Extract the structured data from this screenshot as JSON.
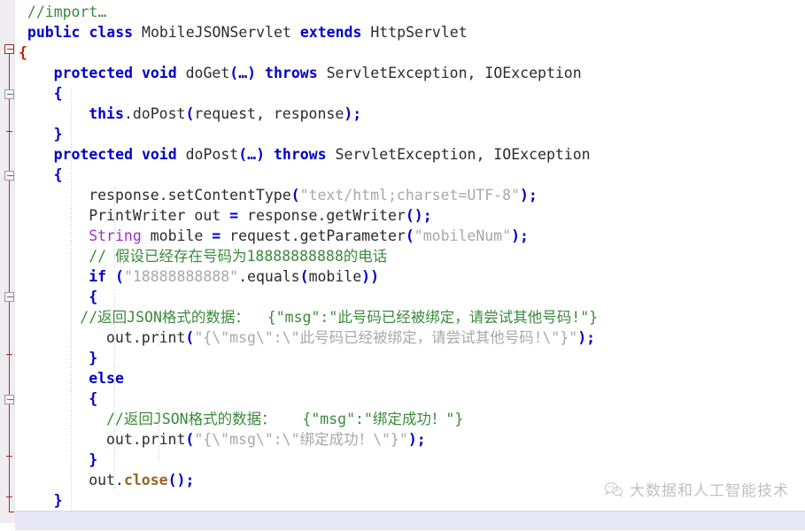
{
  "editor": {
    "language": "java",
    "line_height_px": 23,
    "colors": {
      "background": "#ffffff",
      "keyword": "#0000c8",
      "comment": "#3a8a3a",
      "string": "#a8a8a8",
      "class_name": "#9b30c8",
      "method": "#9a6324",
      "punctuation": "#0000c8",
      "unmatched_brace": "#cc2200",
      "current_line": "#e6e6f5",
      "gutter": "#f2f0f2",
      "fold_bar": "#a52a2a"
    },
    "lines": [
      {
        "indent": 1,
        "tokens": [
          {
            "t": "cmt",
            "v": "//import…"
          }
        ]
      },
      {
        "indent": 1,
        "tokens": [
          {
            "t": "kw",
            "v": "public"
          },
          {
            "t": "plain",
            "v": " "
          },
          {
            "t": "kw",
            "v": "class"
          },
          {
            "t": "plain",
            "v": " "
          },
          {
            "t": "id",
            "v": "MobileJSONServlet"
          },
          {
            "t": "plain",
            "v": " "
          },
          {
            "t": "kw",
            "v": "extends"
          },
          {
            "t": "plain",
            "v": " "
          },
          {
            "t": "id",
            "v": "HttpServlet"
          }
        ]
      },
      {
        "indent": 0,
        "tokens": [
          {
            "t": "redbrace",
            "v": "{"
          }
        ]
      },
      {
        "indent": 4,
        "tokens": [
          {
            "t": "kw",
            "v": "protected"
          },
          {
            "t": "plain",
            "v": " "
          },
          {
            "t": "kw",
            "v": "void"
          },
          {
            "t": "plain",
            "v": " "
          },
          {
            "t": "id",
            "v": "doGet"
          },
          {
            "t": "punct",
            "v": "(…)"
          },
          {
            "t": "plain",
            "v": " "
          },
          {
            "t": "kw",
            "v": "throws"
          },
          {
            "t": "plain",
            "v": " "
          },
          {
            "t": "id",
            "v": "ServletException, IOException"
          }
        ]
      },
      {
        "indent": 4,
        "tokens": [
          {
            "t": "punct",
            "v": "{"
          }
        ]
      },
      {
        "indent": 8,
        "tokens": [
          {
            "t": "kw",
            "v": "this"
          },
          {
            "t": "plain",
            "v": "."
          },
          {
            "t": "id",
            "v": "doPost"
          },
          {
            "t": "punct",
            "v": "("
          },
          {
            "t": "id",
            "v": "request, response"
          },
          {
            "t": "punct",
            "v": ");"
          }
        ]
      },
      {
        "indent": 4,
        "tokens": [
          {
            "t": "punct",
            "v": "}"
          }
        ]
      },
      {
        "indent": 4,
        "tokens": [
          {
            "t": "kw",
            "v": "protected"
          },
          {
            "t": "plain",
            "v": " "
          },
          {
            "t": "kw",
            "v": "void"
          },
          {
            "t": "plain",
            "v": " "
          },
          {
            "t": "id",
            "v": "doPost"
          },
          {
            "t": "punct",
            "v": "(…)"
          },
          {
            "t": "plain",
            "v": " "
          },
          {
            "t": "kw",
            "v": "throws"
          },
          {
            "t": "plain",
            "v": " "
          },
          {
            "t": "id",
            "v": "ServletException, IOException"
          }
        ]
      },
      {
        "indent": 4,
        "tokens": [
          {
            "t": "punct",
            "v": "{"
          }
        ]
      },
      {
        "indent": 8,
        "tokens": [
          {
            "t": "id",
            "v": "response.setContentType"
          },
          {
            "t": "punct",
            "v": "("
          },
          {
            "t": "str",
            "v": "\"text/html;charset=UTF-8\""
          },
          {
            "t": "punct",
            "v": ");"
          }
        ]
      },
      {
        "indent": 8,
        "tokens": [
          {
            "t": "id",
            "v": "PrintWriter out "
          },
          {
            "t": "punct",
            "v": "="
          },
          {
            "t": "id",
            "v": " response.getWriter"
          },
          {
            "t": "punct",
            "v": "();"
          }
        ]
      },
      {
        "indent": 8,
        "tokens": [
          {
            "t": "cls",
            "v": "String"
          },
          {
            "t": "id",
            "v": " mobile "
          },
          {
            "t": "punct",
            "v": "="
          },
          {
            "t": "id",
            "v": " request.getParameter"
          },
          {
            "t": "punct",
            "v": "("
          },
          {
            "t": "str",
            "v": "\"mobileNum\""
          },
          {
            "t": "punct",
            "v": ");"
          }
        ]
      },
      {
        "indent": 8,
        "tokens": [
          {
            "t": "cmt",
            "v": "// 假设已经存在号码为18888888888的电话"
          }
        ]
      },
      {
        "indent": 8,
        "tokens": [
          {
            "t": "kw",
            "v": "if"
          },
          {
            "t": "plain",
            "v": " "
          },
          {
            "t": "punct",
            "v": "("
          },
          {
            "t": "str",
            "v": "\"18888888888\""
          },
          {
            "t": "plain",
            "v": "."
          },
          {
            "t": "id",
            "v": "equals"
          },
          {
            "t": "punct",
            "v": "("
          },
          {
            "t": "id",
            "v": "mobile"
          },
          {
            "t": "punct",
            "v": "))"
          }
        ]
      },
      {
        "indent": 8,
        "tokens": [
          {
            "t": "punct",
            "v": "{"
          }
        ]
      },
      {
        "indent": 7,
        "tokens": [
          {
            "t": "cmt",
            "v": "//返回JSON格式的数据：  {\"msg\":\"此号码已经被绑定，请尝试其他号码!\"}"
          }
        ]
      },
      {
        "indent": 10,
        "tokens": [
          {
            "t": "id",
            "v": "out.print"
          },
          {
            "t": "punct",
            "v": "("
          },
          {
            "t": "str",
            "v": "\"{\\\"msg\\\":\\\"此号码已经被绑定，请尝试其他号码!\\\"}\""
          },
          {
            "t": "punct",
            "v": ");"
          }
        ]
      },
      {
        "indent": 8,
        "tokens": [
          {
            "t": "punct",
            "v": "}"
          }
        ]
      },
      {
        "indent": 8,
        "tokens": [
          {
            "t": "kw",
            "v": "else"
          }
        ]
      },
      {
        "indent": 8,
        "tokens": [
          {
            "t": "punct",
            "v": "{"
          }
        ]
      },
      {
        "indent": 10,
        "tokens": [
          {
            "t": "cmt",
            "v": "//返回JSON格式的数据：   {\"msg\":\"绑定成功！\"}"
          }
        ]
      },
      {
        "indent": 10,
        "tokens": [
          {
            "t": "id",
            "v": "out.print"
          },
          {
            "t": "punct",
            "v": "("
          },
          {
            "t": "str",
            "v": "\"{\\\"msg\\\":\\\"绑定成功！\\\"}\""
          },
          {
            "t": "punct",
            "v": ");"
          }
        ]
      },
      {
        "indent": 8,
        "tokens": [
          {
            "t": "punct",
            "v": "}"
          }
        ]
      },
      {
        "indent": 8,
        "tokens": [
          {
            "t": "id",
            "v": "out."
          },
          {
            "t": "method",
            "v": "close"
          },
          {
            "t": "punct",
            "v": "();"
          }
        ]
      },
      {
        "indent": 4,
        "tokens": [
          {
            "t": "punct",
            "v": "}"
          }
        ]
      },
      {
        "indent": 0,
        "tokens": [
          {
            "t": "redbrace",
            "v": "}"
          }
        ],
        "current": true
      }
    ]
  },
  "watermark": {
    "icon": "wechat-icon",
    "text": "大数据和人工智能技术"
  }
}
